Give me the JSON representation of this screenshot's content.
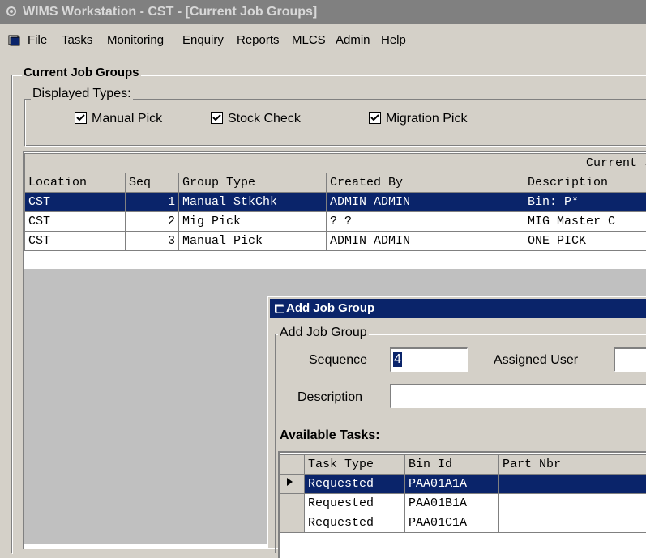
{
  "window": {
    "title": "WIMS Workstation - CST - [Current Job Groups]"
  },
  "menu": {
    "items": [
      "File",
      "Tasks",
      "Monitoring",
      "Enquiry",
      "Reports",
      "MLCS",
      "Admin",
      "Help"
    ]
  },
  "form": {
    "title": "Current Job Groups",
    "displayed_types": {
      "label": "Displayed Types:",
      "options": [
        {
          "label": "Manual Pick",
          "checked": true
        },
        {
          "label": "Stock Check",
          "checked": true
        },
        {
          "label": "Migration Pick",
          "checked": true
        }
      ]
    },
    "grid": {
      "caption": "Current J",
      "columns": [
        "Location",
        "Seq",
        "Group Type",
        "Created By",
        "Description"
      ],
      "rows": [
        {
          "location": "CST",
          "seq": "1",
          "group_type": "Manual StkChk",
          "created_by": "ADMIN ADMIN",
          "description": "Bin: P*",
          "selected": true
        },
        {
          "location": "CST",
          "seq": "2",
          "group_type": "Mig Pick",
          "created_by": "? ?",
          "description": "MIG Master C",
          "selected": false
        },
        {
          "location": "CST",
          "seq": "3",
          "group_type": "Manual Pick",
          "created_by": "ADMIN ADMIN",
          "description": "ONE PICK",
          "selected": false
        }
      ]
    }
  },
  "dialog": {
    "title": "Add Job Group",
    "frame_title": "Add Job Group",
    "sequence_label": "Sequence",
    "sequence_value": "4",
    "assigned_user_label": "Assigned User",
    "assigned_user_value": "",
    "description_label": "Description",
    "description_value": "",
    "available_tasks_label": "Available Tasks:",
    "tasks_columns": [
      "Task Type",
      "Bin Id",
      "Part Nbr"
    ],
    "tasks_rows": [
      {
        "task_type": "Requested",
        "bin_id": "PAA01A1A",
        "part_nbr": "",
        "selected": true
      },
      {
        "task_type": "Requested",
        "bin_id": "PAA01B1A",
        "part_nbr": "",
        "selected": false
      },
      {
        "task_type": "Requested",
        "bin_id": "PAA01C1A",
        "part_nbr": "",
        "selected": false
      }
    ]
  },
  "colors": {
    "face": "#d4d0c8",
    "selection": "#0a246a",
    "inactive_title": "#808080"
  }
}
